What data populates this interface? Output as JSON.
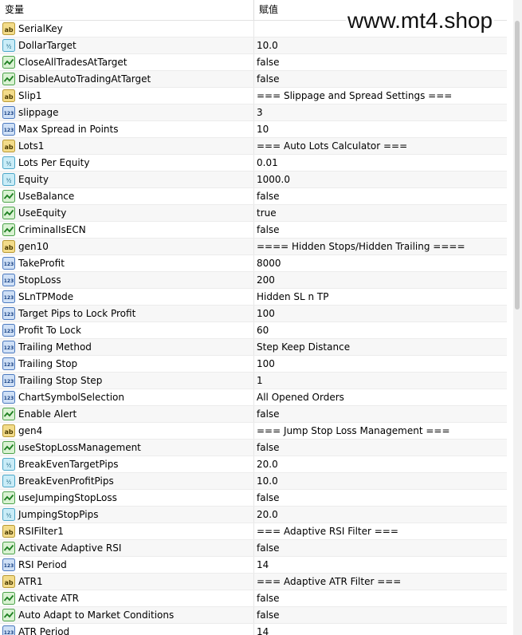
{
  "header": {
    "col_name": "变量",
    "col_value": "赋值"
  },
  "watermark": "www.mt4.shop",
  "rows": [
    {
      "icon": "ab",
      "name": "SerialKey",
      "value": ""
    },
    {
      "icon": "v2",
      "name": "DollarTarget",
      "value": "10.0"
    },
    {
      "icon": "bool",
      "name": "CloseAllTradesAtTarget",
      "value": "false"
    },
    {
      "icon": "bool",
      "name": "DisableAutoTradingAtTarget",
      "value": "false"
    },
    {
      "icon": "ab",
      "name": "Slip1",
      "value": "=== Slippage and Spread Settings ==="
    },
    {
      "icon": "123",
      "name": "slippage",
      "value": "3"
    },
    {
      "icon": "123",
      "name": "Max Spread in Points",
      "value": "10"
    },
    {
      "icon": "ab",
      "name": "Lots1",
      "value": "=== Auto Lots Calculator ==="
    },
    {
      "icon": "v2",
      "name": "Lots Per Equity",
      "value": "0.01"
    },
    {
      "icon": "v2",
      "name": "Equity",
      "value": "1000.0"
    },
    {
      "icon": "bool",
      "name": "UseBalance",
      "value": "false"
    },
    {
      "icon": "bool",
      "name": "UseEquity",
      "value": "true"
    },
    {
      "icon": "bool",
      "name": "CriminalIsECN",
      "value": "false"
    },
    {
      "icon": "ab",
      "name": "gen10",
      "value": "==== Hidden Stops/Hidden Trailing ===="
    },
    {
      "icon": "123",
      "name": "TakeProfit",
      "value": "8000"
    },
    {
      "icon": "123",
      "name": "StopLoss",
      "value": "200"
    },
    {
      "icon": "123",
      "name": "SLnTPMode",
      "value": "Hidden SL n TP"
    },
    {
      "icon": "123",
      "name": "Target Pips to Lock Profit",
      "value": "100"
    },
    {
      "icon": "123",
      "name": "Profit To Lock",
      "value": "60"
    },
    {
      "icon": "123",
      "name": "Trailing Method",
      "value": "Step Keep Distance"
    },
    {
      "icon": "123",
      "name": "Trailing Stop",
      "value": "100"
    },
    {
      "icon": "123",
      "name": "Trailing Stop Step",
      "value": "1"
    },
    {
      "icon": "123",
      "name": "ChartSymbolSelection",
      "value": "All Opened Orders"
    },
    {
      "icon": "bool",
      "name": "Enable Alert",
      "value": "false"
    },
    {
      "icon": "ab",
      "name": "gen4",
      "value": "=== Jump Stop Loss Management ==="
    },
    {
      "icon": "bool",
      "name": "useStopLossManagement",
      "value": "false"
    },
    {
      "icon": "v2",
      "name": "BreakEvenTargetPips",
      "value": "20.0"
    },
    {
      "icon": "v2",
      "name": "BreakEvenProfitPips",
      "value": "10.0"
    },
    {
      "icon": "bool",
      "name": "useJumpingStopLoss",
      "value": "false"
    },
    {
      "icon": "v2",
      "name": "JumpingStopPips",
      "value": "20.0"
    },
    {
      "icon": "ab",
      "name": "RSIFilter1",
      "value": "=== Adaptive RSI Filter ==="
    },
    {
      "icon": "bool",
      "name": "Activate Adaptive RSI",
      "value": "false"
    },
    {
      "icon": "123",
      "name": "RSI Period",
      "value": "14"
    },
    {
      "icon": "ab",
      "name": "ATR1",
      "value": "=== Adaptive ATR Filter ==="
    },
    {
      "icon": "bool",
      "name": "Activate ATR",
      "value": "false"
    },
    {
      "icon": "bool",
      "name": "Auto Adapt to Market Conditions",
      "value": "false"
    },
    {
      "icon": "123",
      "name": "ATR Period",
      "value": "14"
    }
  ]
}
